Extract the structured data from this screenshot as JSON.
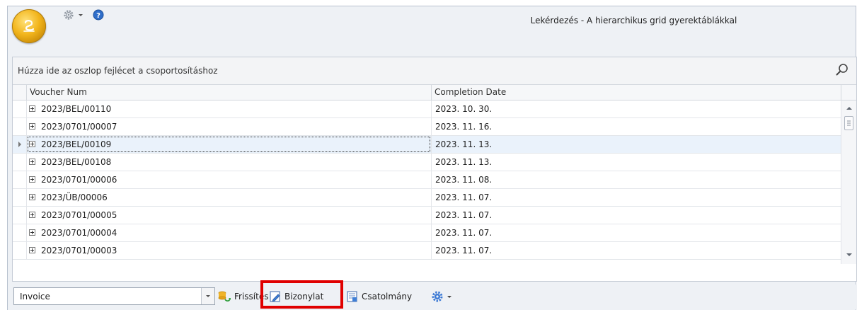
{
  "window": {
    "title": "Lekérdezés - A hierarchikus grid gyerektáblákkal"
  },
  "qat": {
    "icons": [
      "app-orb-icon",
      "gear-icon",
      "dropdown-arrow-icon",
      "help-icon"
    ]
  },
  "grid": {
    "group_panel_text": "Húzza ide az oszlop fejlécet a csoportosításhoz",
    "columns": [
      "Voucher Num",
      "Completion Date"
    ],
    "rows": [
      {
        "voucher": "2023/BEL/00110",
        "date": "2023. 10. 30."
      },
      {
        "voucher": "2023/0701/00007",
        "date": "2023. 11. 16."
      },
      {
        "voucher": "2023/BEL/00109",
        "date": "2023. 11. 13."
      },
      {
        "voucher": "2023/BEL/00108",
        "date": "2023. 11. 13."
      },
      {
        "voucher": "2023/0701/00006",
        "date": "2023. 11. 08."
      },
      {
        "voucher": "2023/ÜB/00006",
        "date": "2023. 11. 07."
      },
      {
        "voucher": "2023/0701/00005",
        "date": "2023. 11. 07."
      },
      {
        "voucher": "2023/0701/00004",
        "date": "2023. 11. 07."
      },
      {
        "voucher": "2023/0701/00003",
        "date": "2023. 11. 07."
      }
    ],
    "selected_row": 2
  },
  "toolbar": {
    "combo_value": "Invoice",
    "refresh_label": "Frissítés",
    "voucher_label": "Bizonylat",
    "attachment_label": "Csatolmány"
  },
  "colors": {
    "highlight": "#e00000",
    "selected_row": "#eaf2fb"
  }
}
